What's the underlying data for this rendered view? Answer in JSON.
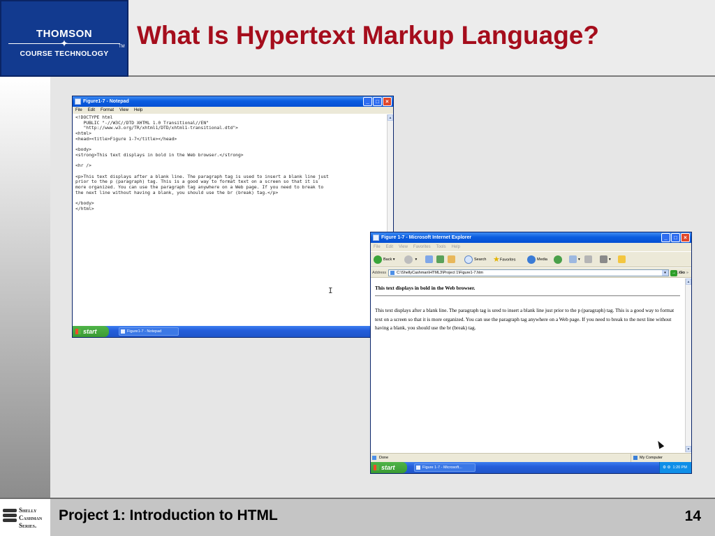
{
  "slide": {
    "title": "What Is Hypertext Markup Language?",
    "footer_title": "Project 1: Introduction to HTML",
    "page_number": "14"
  },
  "logos": {
    "thomson_top": "THOMSON",
    "thomson_bottom": "COURSE TECHNOLOGY",
    "thomson_tm": "TM",
    "shelly_cashman": [
      "Shelly",
      "Cashman",
      "Series."
    ]
  },
  "notepad": {
    "title": "Figure1-7 - Notepad",
    "menu": [
      "File",
      "Edit",
      "Format",
      "View",
      "Help"
    ],
    "content_lines": [
      "<!DOCTYPE html",
      "   PUBLIC \"-//W3C//DTD XHTML 1.0 Transitional//EN\"",
      "   \"http://www.w3.org/TR/xhtml1/DTD/xhtml1-transitional.dtd\">",
      "<html>",
      "<head><title>Figure 1-7</title></head>",
      "",
      "<body>",
      "<strong>This text displays in bold in the Web browser.</strong>",
      "",
      "<hr />",
      "",
      "<p>This text displays after a blank line. The paragraph tag is used to insert a blank line just",
      "prior to the p (paragraph) tag. This is a good way to format text on a screen so that it is",
      "more organized. You can use the paragraph tag anywhere on a Web page. If you need to break to",
      "the next line without having a blank, you should use the br (break) tag.</p>",
      "",
      "</body>",
      "</html>"
    ],
    "taskbar": {
      "start": "start",
      "task": "Figure1-7 - Notepad"
    }
  },
  "ie": {
    "title": "Figure 1-7 - Microsoft Internet Explorer",
    "menu": [
      "File",
      "Edit",
      "View",
      "Favorites",
      "Tools",
      "Help"
    ],
    "toolbar": {
      "back": "Back",
      "search": "Search",
      "favorites": "Favorites",
      "media": "Media"
    },
    "address_label": "Address",
    "address": "C:\\ShellyCashman\\HTML3\\Project 1\\Figure1-7.htm",
    "go": "Go",
    "links": "Links",
    "page": {
      "bold_text": "This text displays in bold in the Web browser.",
      "paragraph": "This text displays after a blank line. The paragraph tag is ured to insert a blank line just prior to the p (paragraph) tag. This is a good way to format text on a screen so that it is more organized. You can use the paragraph tag anywhere on a Web page. If you need to break to the next line without having a blank, you should use the br (break) tag."
    },
    "status": "Done",
    "zone": "My Computer",
    "taskbar": {
      "start": "start",
      "task": "Figure 1-7 - Microsoft...",
      "clock": "1:20 PM"
    }
  },
  "colors": {
    "title_red": "#a50d1c",
    "logo_blue": "#123a8f",
    "xp_titlebar": "#0a5de0"
  }
}
